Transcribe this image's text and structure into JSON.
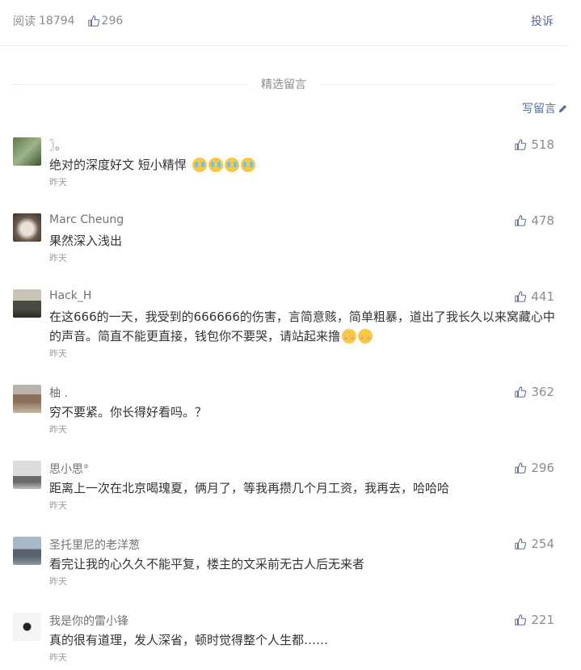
{
  "header": {
    "read_label": "阅读",
    "read_count": "18794",
    "like_count": "296",
    "complaint": "投诉"
  },
  "section": {
    "title": "精选留言",
    "write": "写留言"
  },
  "comments": [
    {
      "nickname": "〗。",
      "content": "绝对的深度好文 短小精悍",
      "time": "昨天",
      "likes": "518"
    },
    {
      "nickname": "Marc Cheung",
      "content": "果然深入浅出",
      "time": "昨天",
      "likes": "478"
    },
    {
      "nickname": "Hack_H",
      "content": "在这666的一天，我受到的666666的伤害，言简意赅，简单粗暴，道出了我长久以来窝藏心中的声音。简直不能更直接，钱包你不要哭，请站起来撸",
      "time": "昨天",
      "likes": "441"
    },
    {
      "nickname": "柚 .",
      "content": "穷不要紧。你长得好看吗。？",
      "time": "昨天",
      "likes": "362"
    },
    {
      "nickname": "思小思°",
      "content": "距离上一次在北京喝瑰夏，俩月了，等我再攒几个月工资，我再去，哈哈哈",
      "time": "昨天",
      "likes": "296"
    },
    {
      "nickname": "圣托里尼的老洋葱",
      "content": "看完让我的心久久不能平复，楼主的文采前无古人后无来者",
      "time": "昨天",
      "likes": "254"
    },
    {
      "nickname": "我是你的雷小锋",
      "content": "真的很有道理，发人深省，顿时觉得整个人生都……",
      "time": "昨天",
      "likes": "221"
    }
  ]
}
